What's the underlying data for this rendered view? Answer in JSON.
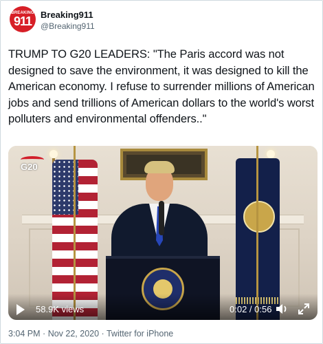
{
  "user": {
    "avatar_text_top": "BREAKING",
    "avatar_text_main": "911",
    "name": "Breaking911",
    "handle": "@Breaking911"
  },
  "tweet": {
    "text": "TRUMP TO G20 LEADERS: \"The Paris accord was not designed to save the environment, it was designed to kill the American economy. I refuse to surrender millions of American jobs and send trillions of American dollars to the world's worst polluters and environmental offenders..\""
  },
  "video": {
    "overlay_logo": "G20",
    "views": "58.9K views",
    "time": "0:02 / 0:56",
    "icons": {
      "play": "play-icon",
      "volume": "volume-icon",
      "fullscreen": "fullscreen-icon"
    }
  },
  "footer": {
    "time": "3:04 PM",
    "separator": "·",
    "date": "Nov 22, 2020",
    "source": "Twitter for iPhone"
  },
  "colors": {
    "brand_red": "#d71f27",
    "text": "#0f1419",
    "secondary_text": "#536471",
    "border": "#cfd9de"
  }
}
